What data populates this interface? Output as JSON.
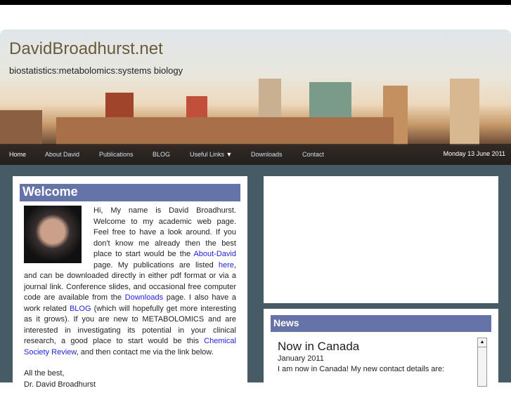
{
  "header": {
    "title": "DavidBroadhurst.net",
    "tagline": "biostatistics:metabolomics:systems biology"
  },
  "nav": {
    "items": [
      "Home",
      "About David",
      "Publications",
      "BLOG",
      "Useful Links",
      "Downloads",
      "Contact"
    ],
    "date": "Monday 13 June 2011"
  },
  "welcome": {
    "heading": "Welcome",
    "p1": "Hi, My name is David Broadhurst. Welcome to my academic web page. Feel free to have a look around. If you don't know me already then the best place to start would be the ",
    "link_about": "About-David",
    "p2": " page. My publications are listed ",
    "link_here": "here",
    "p3": ", and can be downloaded directly in either pdf format or via a journal link. Conference slides, and occasional free computer code are available from the ",
    "link_downloads": "Downloads",
    "p4": " page. I also have a work related ",
    "link_blog": "BLOG",
    "p5": " (which will hopefully get more interesting as it grows). If you are new to METABOLOMICS and are interested in investigating its potential in your clinical research, a good place to start would be this ",
    "link_csr": "Chemical Society Review",
    "p6": ", and then contact me via the link below.",
    "signoff": "All the best,",
    "signature": "Dr. David Broadhurst"
  },
  "news": {
    "heading": "News",
    "title": "Now in Canada",
    "date": "January 2011",
    "text": "I am now in Canada! My new contact details are:"
  }
}
